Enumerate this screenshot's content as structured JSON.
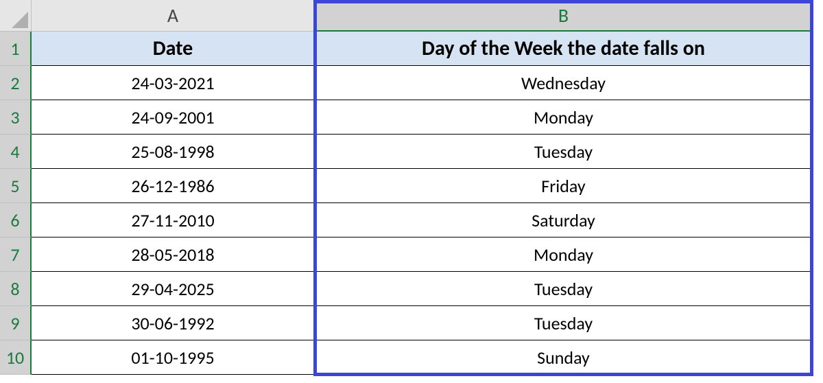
{
  "columns": {
    "A": "A",
    "B": "B"
  },
  "row_labels": [
    "1",
    "2",
    "3",
    "4",
    "5",
    "6",
    "7",
    "8",
    "9",
    "10"
  ],
  "headers": {
    "A": "Date",
    "B": "Day of the Week the date falls on"
  },
  "rows": [
    {
      "date": "24-03-2021",
      "day": "Wednesday"
    },
    {
      "date": "24-09-2001",
      "day": "Monday"
    },
    {
      "date": "25-08-1998",
      "day": "Tuesday"
    },
    {
      "date": "26-12-1986",
      "day": "Friday"
    },
    {
      "date": "27-11-2010",
      "day": "Saturday"
    },
    {
      "date": "28-05-2018",
      "day": "Monday"
    },
    {
      "date": "29-04-2025",
      "day": "Tuesday"
    },
    {
      "date": "30-06-1992",
      "day": "Tuesday"
    },
    {
      "date": "01-10-1995",
      "day": "Sunday"
    }
  ],
  "selection": {
    "col": "B",
    "row_start": 1,
    "row_end": 10
  }
}
